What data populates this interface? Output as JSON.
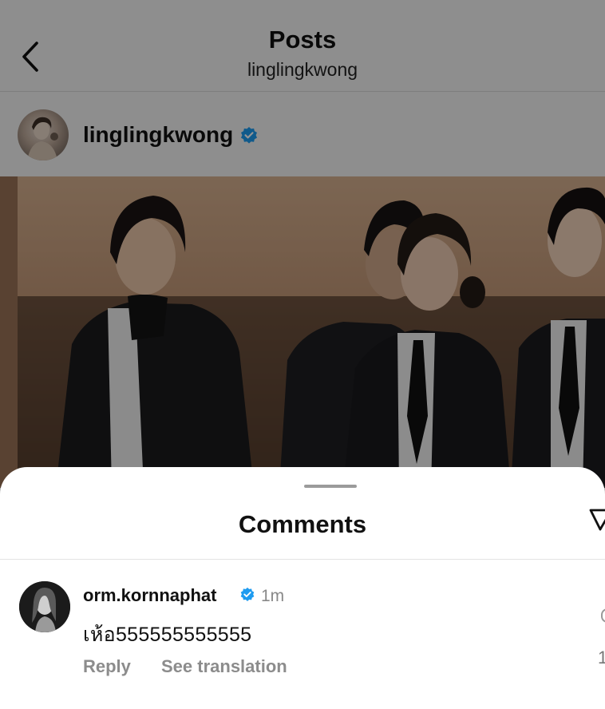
{
  "header": {
    "title": "Posts",
    "subtitle": "linglingkwong"
  },
  "post": {
    "author": "linglingkwong",
    "verified": true
  },
  "comments_sheet": {
    "title": "Comments",
    "items": [
      {
        "username": "orm.kornnaphat",
        "verified": true,
        "time": "1m",
        "text": "เห้อ555555555555",
        "reply_label": "Reply",
        "translate_label": "See translation",
        "like_count_partial": "1"
      }
    ]
  },
  "colors": {
    "verified_badge": "#1d9bf0",
    "secondary_text": "#8c8c8c"
  }
}
